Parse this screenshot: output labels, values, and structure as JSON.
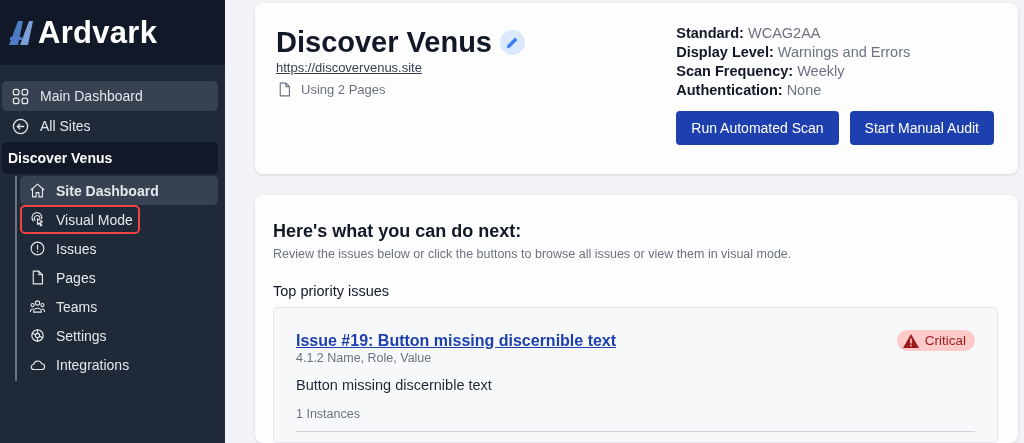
{
  "logo": {
    "text": "Ardvark"
  },
  "sidebar": {
    "items": [
      {
        "label": "Main Dashboard",
        "selected": true
      },
      {
        "label": "All Sites",
        "selected": false
      }
    ],
    "site": {
      "name": "Discover Venus",
      "items": [
        {
          "label": "Site Dashboard",
          "selected": true,
          "highlighted": false
        },
        {
          "label": "Visual Mode",
          "selected": false,
          "highlighted": true
        },
        {
          "label": "Issues",
          "selected": false,
          "highlighted": false
        },
        {
          "label": "Pages",
          "selected": false,
          "highlighted": false
        },
        {
          "label": "Teams",
          "selected": false,
          "highlighted": false
        },
        {
          "label": "Settings",
          "selected": false,
          "highlighted": false
        },
        {
          "label": "Integrations",
          "selected": false,
          "highlighted": false
        }
      ]
    }
  },
  "site_header": {
    "title": "Discover Venus",
    "url": "https://discovervenus.site",
    "pages": "Using 2 Pages",
    "details": [
      {
        "label": "Standard:",
        "value": "WCAG2AA"
      },
      {
        "label": "Display Level:",
        "value": "Warnings and Errors"
      },
      {
        "label": "Scan Frequency:",
        "value": "Weekly"
      },
      {
        "label": "Authentication:",
        "value": "None"
      }
    ],
    "buttons": [
      "Run Automated Scan",
      "Start Manual Audit"
    ]
  },
  "next_steps": {
    "title": "Here's what you can do next:",
    "subtitle": "Review the issues below or click the buttons to browse all issues or view them in visual mode.",
    "section": "Top priority issues",
    "issues": [
      {
        "title": "Issue #19: Button missing discernible text",
        "criterion": "4.1.2 Name, Role, Value",
        "description": "Button missing discernible text",
        "instances": "1 Instances",
        "severity": "Critical",
        "kind": "critical"
      }
    ]
  }
}
